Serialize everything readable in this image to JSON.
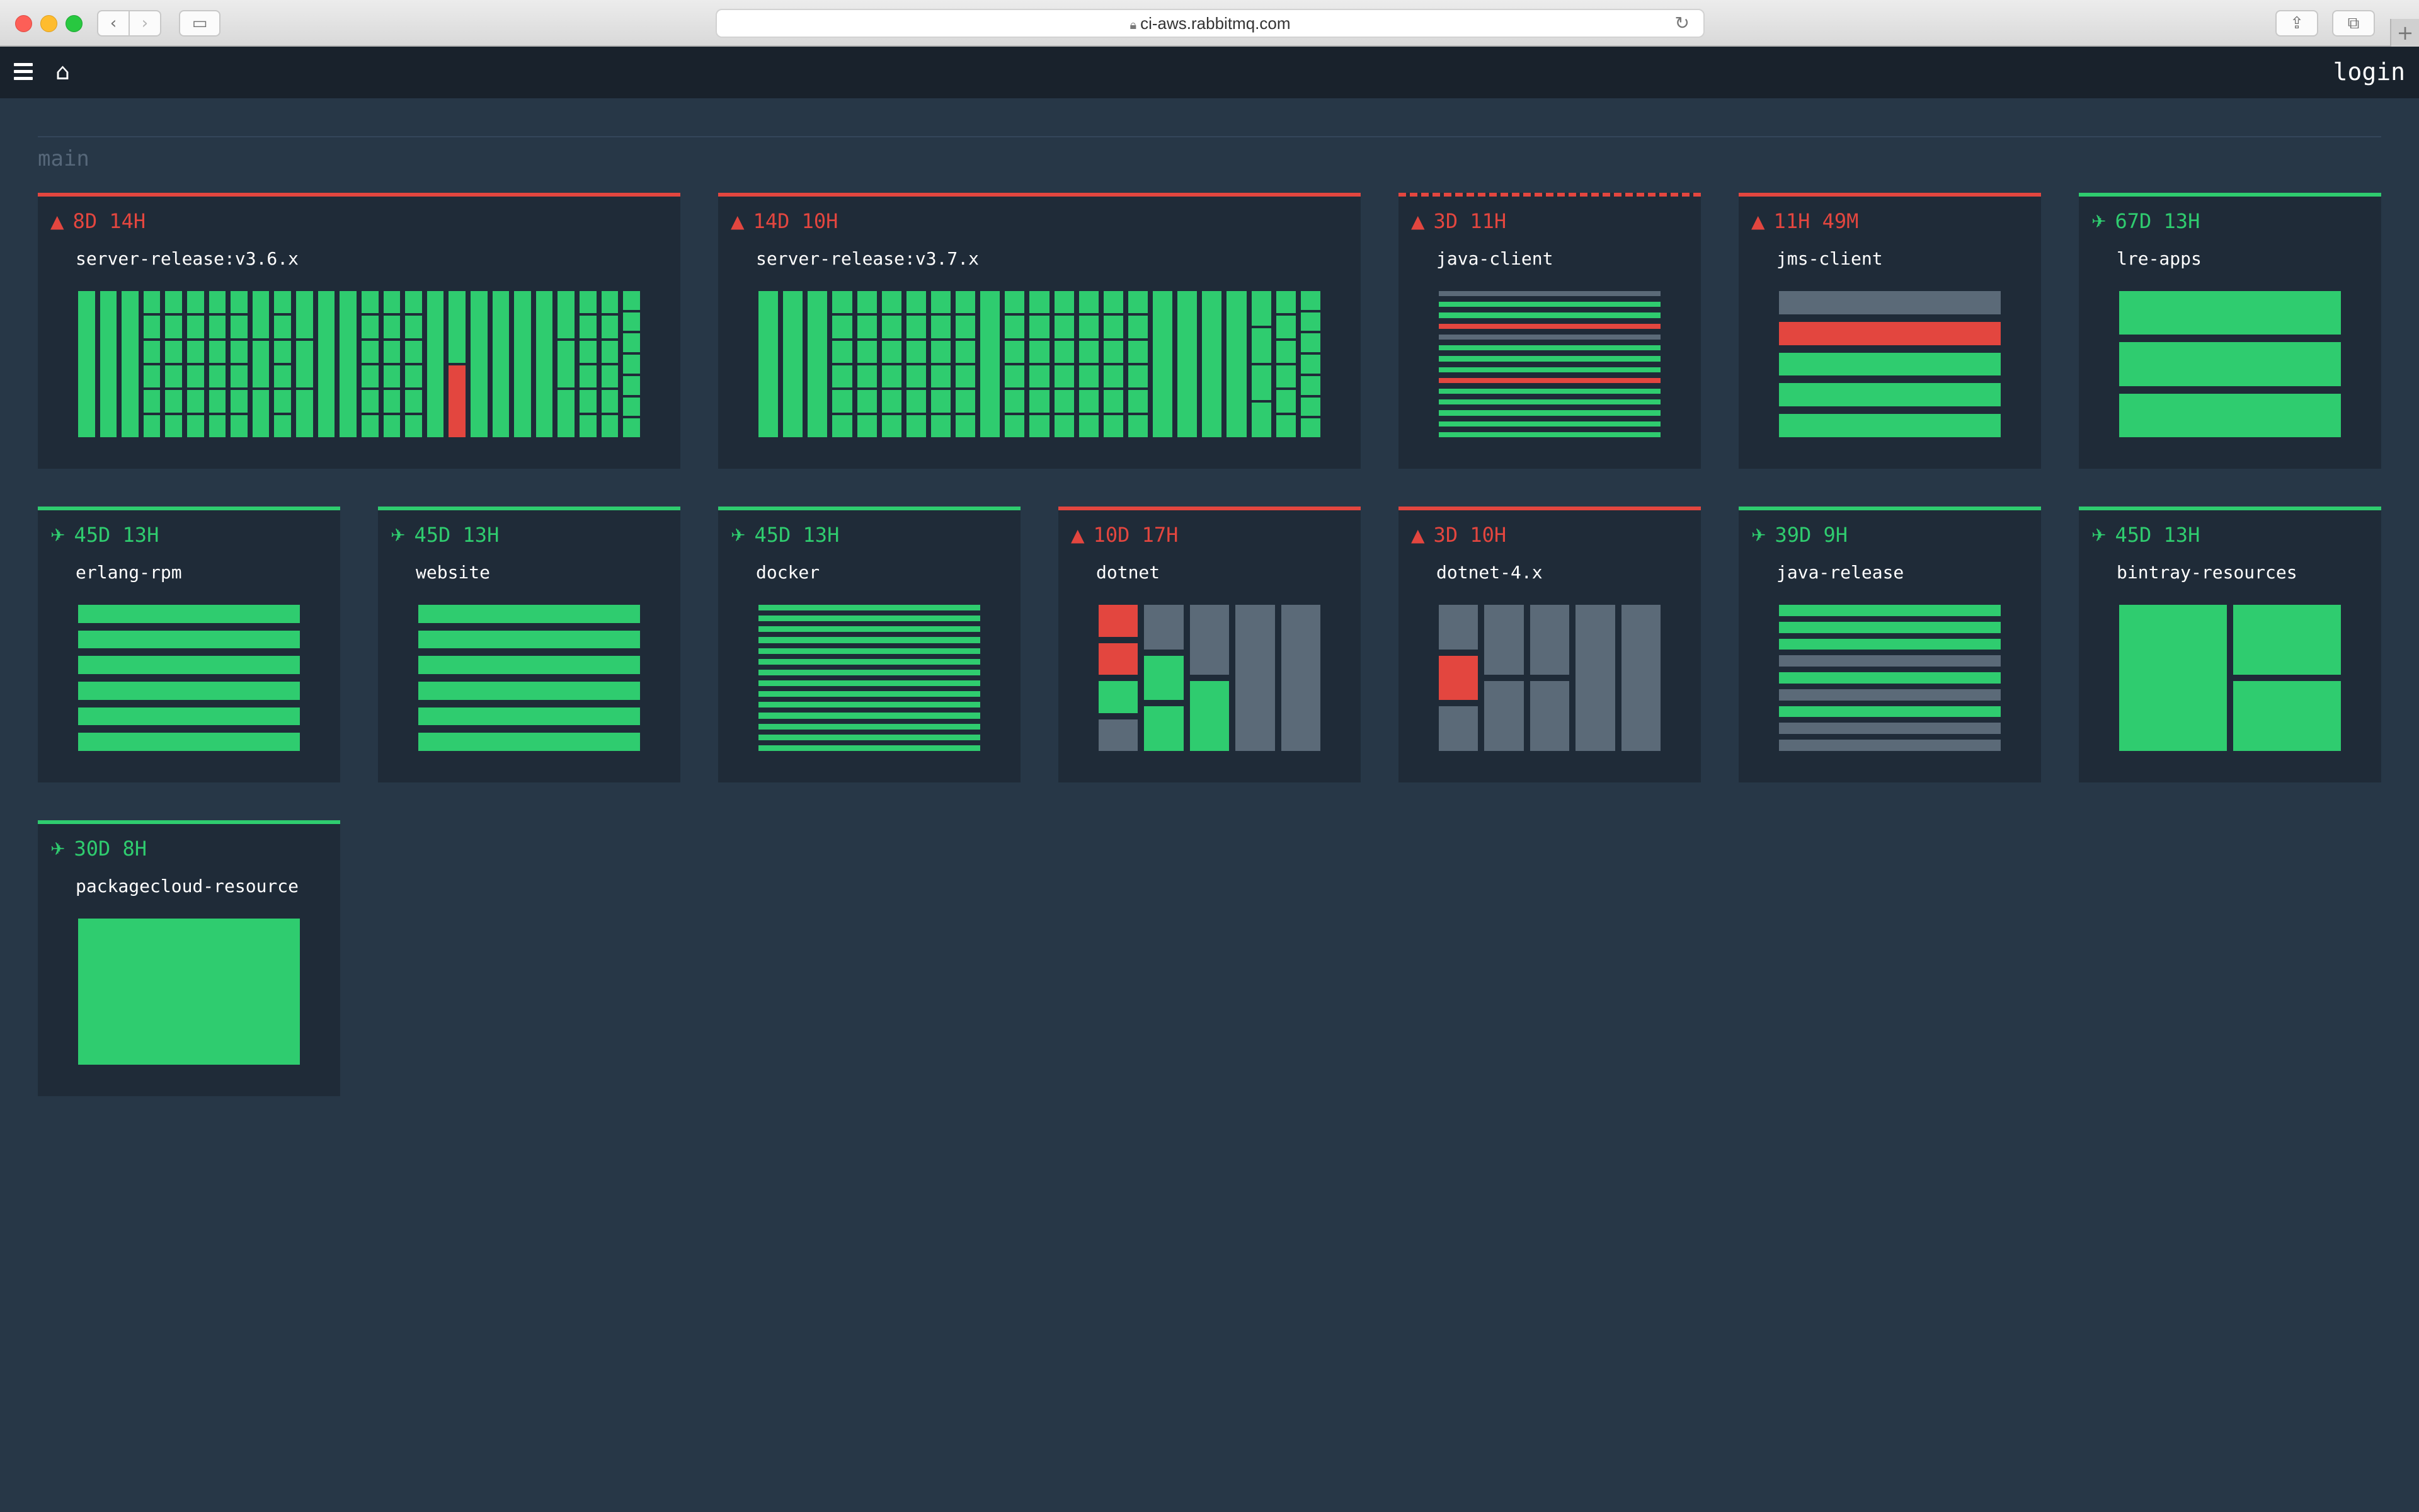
{
  "browser": {
    "url": "ci-aws.rabbitmq.com"
  },
  "topbar": {
    "login_label": "login"
  },
  "group_name": "main",
  "colors": {
    "succeeded": "#2fcc6f",
    "failed": "#e3463f",
    "pending": "#5b6a78",
    "background": "#273747",
    "card": "#1f2b38"
  },
  "icons": {
    "failed": "warning-triangle-icon",
    "succeeded": "plane-icon"
  },
  "pipelines": [
    {
      "name": "server-release:v3.6.x",
      "since": "8D 14H",
      "status": "failed"
    },
    {
      "name": "server-release:v3.7.x",
      "since": "14D 10H",
      "status": "failed"
    },
    {
      "name": "java-client",
      "since": "3D 11H",
      "status": "failed-running"
    },
    {
      "name": "jms-client",
      "since": "11H 49M",
      "status": "failed"
    },
    {
      "name": "lre-apps",
      "since": "67D 13H",
      "status": "succeeded"
    },
    {
      "name": "erlang-rpm",
      "since": "45D 13H",
      "status": "succeeded"
    },
    {
      "name": "website",
      "since": "45D 13H",
      "status": "succeeded"
    },
    {
      "name": "docker",
      "since": "45D 13H",
      "status": "succeeded"
    },
    {
      "name": "dotnet",
      "since": "10D 17H",
      "status": "failed"
    },
    {
      "name": "dotnet-4.x",
      "since": "3D 10H",
      "status": "failed"
    },
    {
      "name": "java-release",
      "since": "39D 9H",
      "status": "succeeded"
    },
    {
      "name": "bintray-resources",
      "since": "45D 13H",
      "status": "succeeded"
    },
    {
      "name": "packagecloud-resource",
      "since": "30D 8H",
      "status": "succeeded"
    }
  ]
}
